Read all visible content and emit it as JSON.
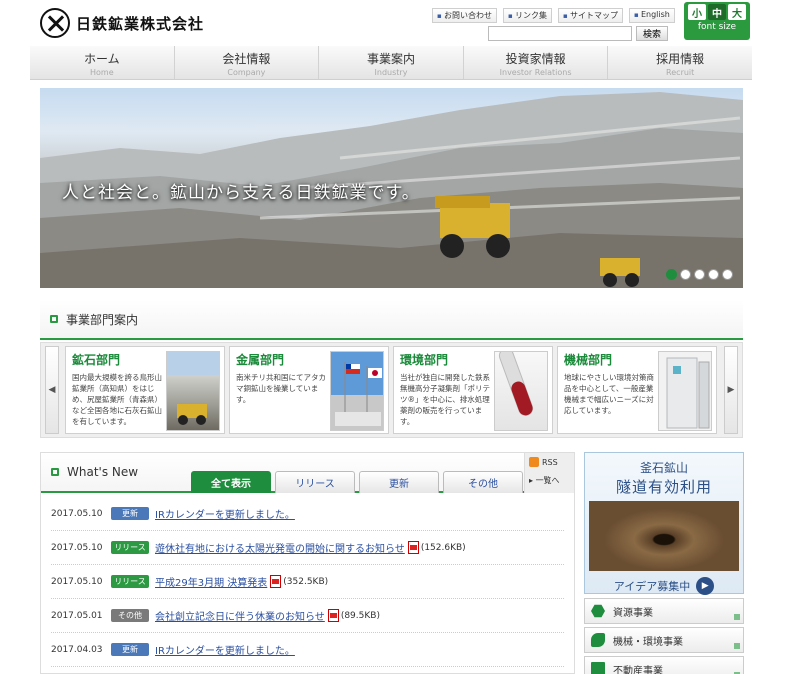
{
  "header": {
    "company_name": "日鉄鉱業株式会社",
    "top_links": [
      "お問い合わせ",
      "リンク集",
      "サイトマップ",
      "English"
    ],
    "search_placeholder": "",
    "search_button": "検索",
    "font_size": {
      "options": [
        "小",
        "中",
        "大"
      ],
      "selected": "中",
      "label": "font size"
    }
  },
  "nav": [
    {
      "label": "ホーム",
      "sub": "Home"
    },
    {
      "label": "会社情報",
      "sub": "Company"
    },
    {
      "label": "事業案内",
      "sub": "Industry"
    },
    {
      "label": "投資家情報",
      "sub": "Investor Relations"
    },
    {
      "label": "採用情報",
      "sub": "Recruit"
    }
  ],
  "hero": {
    "tagline": "人と社会と。鉱山から支える日鉄鉱業です。",
    "slide_count": 5,
    "active_slide": 1
  },
  "divisions": {
    "title": "事業部門案内",
    "items": [
      {
        "title": "鉱石部門",
        "desc": "国内最大規模を誇る鳥形山鉱業所（高知県）をはじめ、尻屋鉱業所（青森県）など全国各地に石灰石鉱山を有しています。",
        "image": "limestone-mine"
      },
      {
        "title": "金属部門",
        "desc": "南米チリ共和国にてアタカマ銅鉱山を操業しています。",
        "image": "chile-flags"
      },
      {
        "title": "環境部門",
        "desc": "当社が独自に開発した鉄系無機高分子凝集剤「ポリテツ®」を中心に、排水処理薬剤の販売を行っています。",
        "image": "test-tube"
      },
      {
        "title": "機械部門",
        "desc": "地球にやさしい環境対策商品を中心として、一般産業機械まで幅広いニーズに対応しています。",
        "image": "machine-unit"
      }
    ]
  },
  "news": {
    "title": "What's New",
    "tabs": [
      "全て表示",
      "リリース",
      "更新",
      "その他"
    ],
    "active_tab": "全て表示",
    "rss": "RSS",
    "more": "一覧へ",
    "items": [
      {
        "date": "2017.05.10",
        "category": "更新",
        "type": "update",
        "title": "IRカレンダーを更新しました。",
        "pdf": false,
        "size": ""
      },
      {
        "date": "2017.05.10",
        "category": "リリース",
        "type": "release",
        "title": "遊休社有地における太陽光発電の開始に関するお知らせ",
        "pdf": true,
        "size": "(152.6KB)"
      },
      {
        "date": "2017.05.10",
        "category": "リリース",
        "type": "release",
        "title": "平成29年3月期 決算発表",
        "pdf": true,
        "size": "(352.5KB)"
      },
      {
        "date": "2017.05.01",
        "category": "その他",
        "type": "other",
        "title": "会社創立記念日に伴う休業のお知らせ",
        "pdf": true,
        "size": "(89.5KB)"
      },
      {
        "date": "2017.04.03",
        "category": "更新",
        "type": "update",
        "title": "IRカレンダーを更新しました。",
        "pdf": false,
        "size": ""
      }
    ]
  },
  "banner": {
    "line1": "釜石鉱山",
    "line2": "隧道有効利用",
    "button": "アイデア募集中"
  },
  "business_links": [
    {
      "label": "資源事業",
      "icon": "resource-icon"
    },
    {
      "label": "機械・環境事業",
      "icon": "wrench-icon"
    },
    {
      "label": "不動産事業",
      "icon": "building-icon"
    }
  ]
}
